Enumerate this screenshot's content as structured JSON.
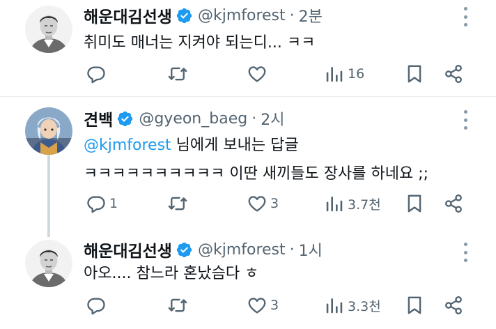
{
  "tweets": [
    {
      "name": "해운대김선생",
      "handle": "@kjmforest",
      "dot": "·",
      "time": "2분",
      "lines": [
        "취미도 매너는 지켜야 되는디... ㅋㅋ"
      ],
      "reply_count": "",
      "retweet_count": "",
      "like_count": "",
      "view_count": "16"
    },
    {
      "name": "견백",
      "handle": "@gyeon_baeg",
      "dot": "·",
      "time": "2시",
      "reply_to_mention": "@kjmforest",
      "reply_to_suffix": " 님에게 보내는 답글",
      "lines": [
        "ㅋㅋㅋㅋㅋㅋㅋㅋㅋㅋ 이딴 새끼들도 장사를 하네요 ;;"
      ],
      "reply_count": "1",
      "retweet_count": "",
      "like_count": "3",
      "view_count": "3.7천"
    },
    {
      "name": "해운대김선생",
      "handle": "@kjmforest",
      "dot": "·",
      "time": "1시",
      "lines": [
        "아오.... 참느라 혼났슴다 ㅎ"
      ],
      "reply_count": "",
      "retweet_count": "",
      "like_count": "3",
      "view_count": "3.3천"
    }
  ],
  "colors": {
    "text": "#0f1419",
    "secondary": "#536471",
    "accent": "#1d9bf0",
    "thread_line": "#cfd9de"
  },
  "icons": [
    "verified-badge-icon",
    "more-icon",
    "reply-icon",
    "retweet-icon",
    "like-icon",
    "views-icon",
    "bookmark-icon",
    "share-icon"
  ]
}
